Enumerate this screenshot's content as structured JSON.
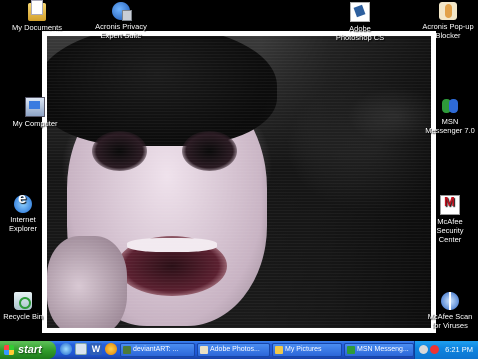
{
  "desktop": {
    "icons_left": [
      {
        "name": "my-documents-icon",
        "label": "My Documents"
      },
      {
        "name": "my-computer-icon",
        "label": "My Computer"
      },
      {
        "name": "internet-explorer-icon",
        "label": "Internet Explorer"
      },
      {
        "name": "recycle-bin-icon",
        "label": "Recycle Bin"
      }
    ],
    "icons_top": [
      {
        "name": "acronis-icon",
        "label": "Acronis Privacy Expert Suite"
      },
      {
        "name": "photoshop-icon",
        "label": "Adobe Photoshop CS"
      },
      {
        "name": "acronis-popup-blocker-icon",
        "label": "Acronis Pop-up Blocker"
      }
    ],
    "icons_right": [
      {
        "name": "msn-messenger-icon",
        "label": "MSN Messenger 7.0"
      },
      {
        "name": "mcafee-security-center-icon",
        "label": "McAfee Security Center"
      },
      {
        "name": "mcafee-scan-icon",
        "label": "McAfee Scan for Viruses"
      }
    ]
  },
  "taskbar": {
    "start_label": "start",
    "quick_launch": [
      "ie-icon",
      "show-desktop-icon",
      "word-icon",
      "media-player-icon"
    ],
    "tasks": [
      {
        "label": "deviantART: ...",
        "icon": "deviantart-icon"
      },
      {
        "label": "Adobe Photos...",
        "icon": "photoshop-icon"
      },
      {
        "label": "My Pictures",
        "icon": "folder-icon"
      },
      {
        "label": "MSN Messeng...",
        "icon": "msn-icon"
      }
    ],
    "clock": "6:21 PM"
  },
  "colors": {
    "taskbar_blue": "#245edb",
    "start_green": "#2f9b2a",
    "tray_blue": "#0f86e0"
  }
}
